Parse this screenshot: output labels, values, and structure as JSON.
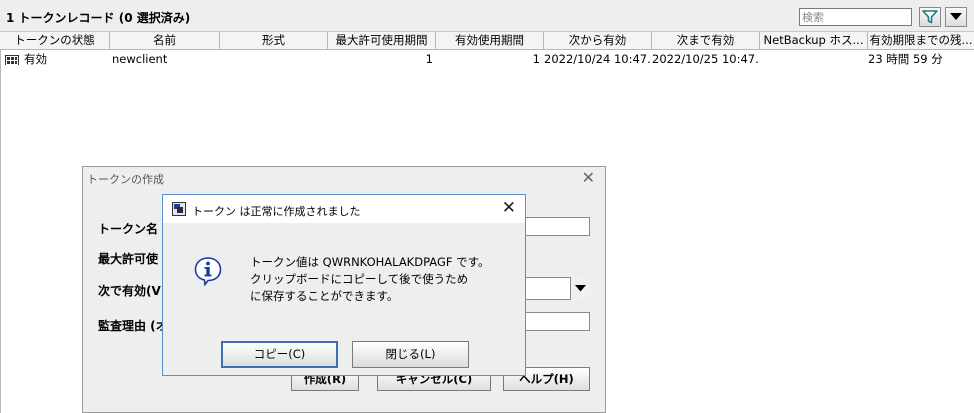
{
  "toolbar": {
    "record_count": "1 トークンレコード (0 選択済み)",
    "search_placeholder": "検索"
  },
  "table": {
    "columns": [
      "トークンの状態",
      "名前",
      "形式",
      "最大許可使用期間",
      "有効使用期間",
      "次から有効",
      "次まで有効",
      "NetBackup ホス...",
      "有効期限までの残..."
    ],
    "rows": [
      {
        "status": "有効",
        "name": "newclient",
        "type": "",
        "max_uses": "1",
        "valid_uses": "1",
        "valid_from": "2022/10/24 10:47...",
        "valid_until": "2022/10/25 10:47...",
        "host": "",
        "time_left": "23 時間 59 分"
      }
    ]
  },
  "create_dialog": {
    "title": "トークンの作成",
    "labels": {
      "token_name": "トークン名",
      "max_uses": "最大許可使",
      "valid_for": "次で有効(V",
      "reason": "監査理由 (オ"
    },
    "buttons": {
      "create": "作成(R)",
      "cancel": "キャンセル(C)",
      "help": "ヘルプ(H)"
    }
  },
  "message_dialog": {
    "title": "トークン は正常に作成されました",
    "lines": [
      "トークン値は QWRNKOHALAKDPAGF です。",
      "クリップボードにコピーして後で使うため",
      "に保存することができます。"
    ],
    "buttons": {
      "copy": "コピー(C)",
      "close": "閉じる(L)"
    }
  },
  "colors": {
    "window_bg": "#eeeeee",
    "dialog_border": "#5b8fd0",
    "filter_icon": "#1f7a7a",
    "info_icon": "#1e3a9a"
  }
}
